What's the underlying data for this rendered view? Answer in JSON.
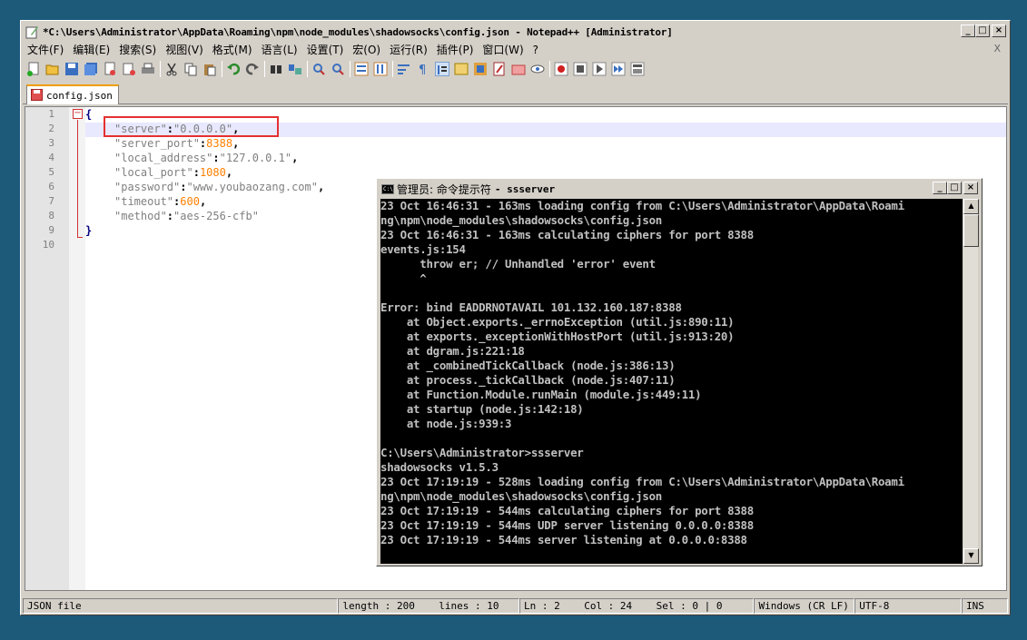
{
  "npp": {
    "title": "*C:\\Users\\Administrator\\AppData\\Roaming\\npm\\node_modules\\shadowsocks\\config.json - Notepad++ [Administrator]",
    "menu": [
      "文件(F)",
      "编辑(E)",
      "搜索(S)",
      "视图(V)",
      "格式(M)",
      "语言(L)",
      "设置(T)",
      "宏(O)",
      "运行(R)",
      "插件(P)",
      "窗口(W)",
      "?"
    ],
    "menu_close": "X",
    "tab_label": "config.json",
    "line_numbers": [
      "1",
      "2",
      "3",
      "4",
      "5",
      "6",
      "7",
      "8",
      "9",
      "10"
    ],
    "code": {
      "l1": "{",
      "l2_key": "\"server\"",
      "l2_val": "\"0.0.0.0\"",
      "l3_key": "\"server_port\"",
      "l3_val": "8388",
      "l4_key": "\"local_address\"",
      "l4_val": "\"127.0.0.1\"",
      "l5_key": "\"local_port\"",
      "l5_val": "1080",
      "l6_key": "\"password\"",
      "l6_val": "\"www.youbaozang.com\"",
      "l7_key": "\"timeout\"",
      "l7_val": "600",
      "l8_key": "\"method\"",
      "l8_val": "\"aes-256-cfb\"",
      "l9": "}",
      "colon": ":",
      "comma": ","
    },
    "status": {
      "filetype": "JSON file",
      "length": "length : 200    lines : 10",
      "position": "Ln : 2    Col : 24    Sel : 0 | 0",
      "eol": "Windows (CR LF)",
      "encoding": "UTF-8",
      "mode": "INS"
    }
  },
  "cmd": {
    "title_cn": "管理员: 命令提示符",
    "title_rest": "- ssserver",
    "lines": [
      "23 Oct 16:46:31 - 163ms loading config from C:\\Users\\Administrator\\AppData\\Roami",
      "ng\\npm\\node_modules\\shadowsocks\\config.json",
      "23 Oct 16:46:31 - 163ms calculating ciphers for port 8388",
      "events.js:154",
      "      throw er; // Unhandled 'error' event",
      "      ^",
      "",
      "Error: bind EADDRNOTAVAIL 101.132.160.187:8388",
      "    at Object.exports._errnoException (util.js:890:11)",
      "    at exports._exceptionWithHostPort (util.js:913:20)",
      "    at dgram.js:221:18",
      "    at _combinedTickCallback (node.js:386:13)",
      "    at process._tickCallback (node.js:407:11)",
      "    at Function.Module.runMain (module.js:449:11)",
      "    at startup (node.js:142:18)",
      "    at node.js:939:3",
      "",
      "C:\\Users\\Administrator>ssserver",
      "shadowsocks v1.5.3",
      "23 Oct 17:19:19 - 528ms loading config from C:\\Users\\Administrator\\AppData\\Roami",
      "ng\\npm\\node_modules\\shadowsocks\\config.json",
      "23 Oct 17:19:19 - 544ms calculating ciphers for port 8388",
      "23 Oct 17:19:19 - 544ms UDP server listening 0.0.0.0:8388",
      "23 Oct 17:19:19 - 544ms server listening at 0.0.0.0:8388"
    ]
  },
  "window_buttons": {
    "minimize": "_",
    "maximize": "□",
    "close": "×"
  },
  "scroll": {
    "up": "▲",
    "down": "▼"
  },
  "colors": {
    "desktop": "#1d5a7a",
    "highlight_box": "#e53030",
    "number": "#ff8000",
    "string": "#808080"
  }
}
